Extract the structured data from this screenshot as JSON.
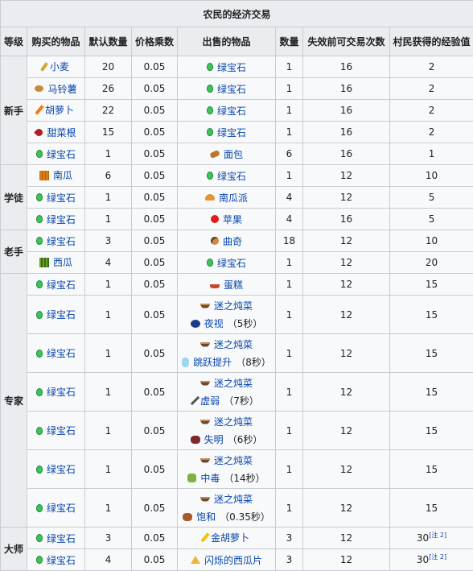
{
  "caption": "农民的经济交易",
  "headers": [
    "等级",
    "购买的物品",
    "默认数量",
    "价格乘数",
    "出售的物品",
    "数量",
    "失效前可交易次数",
    "村民获得的经验值"
  ],
  "levels": {
    "novice": "新手",
    "apprentice": "学徒",
    "journeyman": "老手",
    "expert": "专家",
    "master": "大师"
  },
  "rows": [
    {
      "buy": "小麦",
      "qty": "20",
      "mult": "0.05",
      "sell": "绿宝石",
      "sqty": "1",
      "uses": "16",
      "xp": "2"
    },
    {
      "buy": "马铃薯",
      "qty": "26",
      "mult": "0.05",
      "sell": "绿宝石",
      "sqty": "1",
      "uses": "16",
      "xp": "2"
    },
    {
      "buy": "胡萝卜",
      "qty": "22",
      "mult": "0.05",
      "sell": "绿宝石",
      "sqty": "1",
      "uses": "16",
      "xp": "2"
    },
    {
      "buy": "甜菜根",
      "qty": "15",
      "mult": "0.05",
      "sell": "绿宝石",
      "sqty": "1",
      "uses": "16",
      "xp": "2"
    },
    {
      "buy": "绿宝石",
      "qty": "1",
      "mult": "0.05",
      "sell": "面包",
      "sqty": "6",
      "uses": "16",
      "xp": "1"
    },
    {
      "buy": "南瓜",
      "qty": "6",
      "mult": "0.05",
      "sell": "绿宝石",
      "sqty": "1",
      "uses": "12",
      "xp": "10"
    },
    {
      "buy": "绿宝石",
      "qty": "1",
      "mult": "0.05",
      "sell": "南瓜派",
      "sqty": "4",
      "uses": "12",
      "xp": "5"
    },
    {
      "buy": "绿宝石",
      "qty": "1",
      "mult": "0.05",
      "sell": "苹果",
      "sqty": "4",
      "uses": "16",
      "xp": "5"
    },
    {
      "buy": "绿宝石",
      "qty": "3",
      "mult": "0.05",
      "sell": "曲奇",
      "sqty": "18",
      "uses": "12",
      "xp": "10"
    },
    {
      "buy": "西瓜",
      "qty": "4",
      "mult": "0.05",
      "sell": "绿宝石",
      "sqty": "1",
      "uses": "12",
      "xp": "20"
    },
    {
      "buy": "绿宝石",
      "qty": "1",
      "mult": "0.05",
      "sell": "蛋糕",
      "sqty": "1",
      "uses": "12",
      "xp": "15"
    },
    {
      "buy": "绿宝石",
      "qty": "1",
      "mult": "0.05",
      "sell": "迷之炖菜",
      "effect": "夜视",
      "dur": "（5秒）",
      "sqty": "1",
      "uses": "12",
      "xp": "15"
    },
    {
      "buy": "绿宝石",
      "qty": "1",
      "mult": "0.05",
      "sell": "迷之炖菜",
      "effect": "跳跃提升",
      "dur": "（8秒）",
      "sqty": "1",
      "uses": "12",
      "xp": "15"
    },
    {
      "buy": "绿宝石",
      "qty": "1",
      "mult": "0.05",
      "sell": "迷之炖菜",
      "effect": "虚弱",
      "dur": "（7秒）",
      "sqty": "1",
      "uses": "12",
      "xp": "15"
    },
    {
      "buy": "绿宝石",
      "qty": "1",
      "mult": "0.05",
      "sell": "迷之炖菜",
      "effect": "失明",
      "dur": "（6秒）",
      "sqty": "1",
      "uses": "12",
      "xp": "15"
    },
    {
      "buy": "绿宝石",
      "qty": "1",
      "mult": "0.05",
      "sell": "迷之炖菜",
      "effect": "中毒",
      "dur": "（14秒）",
      "sqty": "1",
      "uses": "12",
      "xp": "15"
    },
    {
      "buy": "绿宝石",
      "qty": "1",
      "mult": "0.05",
      "sell": "迷之炖菜",
      "effect": "饱和",
      "dur": "（0.35秒）",
      "sqty": "1",
      "uses": "12",
      "xp": "15"
    },
    {
      "buy": "绿宝石",
      "qty": "3",
      "mult": "0.05",
      "sell": "金胡萝卜",
      "sqty": "3",
      "uses": "12",
      "xp": "30",
      "note": "[注 2]"
    },
    {
      "buy": "绿宝石",
      "qty": "4",
      "mult": "0.05",
      "sell": "闪烁的西瓜片",
      "sqty": "3",
      "uses": "12",
      "xp": "30",
      "note": "[注 2]"
    }
  ]
}
